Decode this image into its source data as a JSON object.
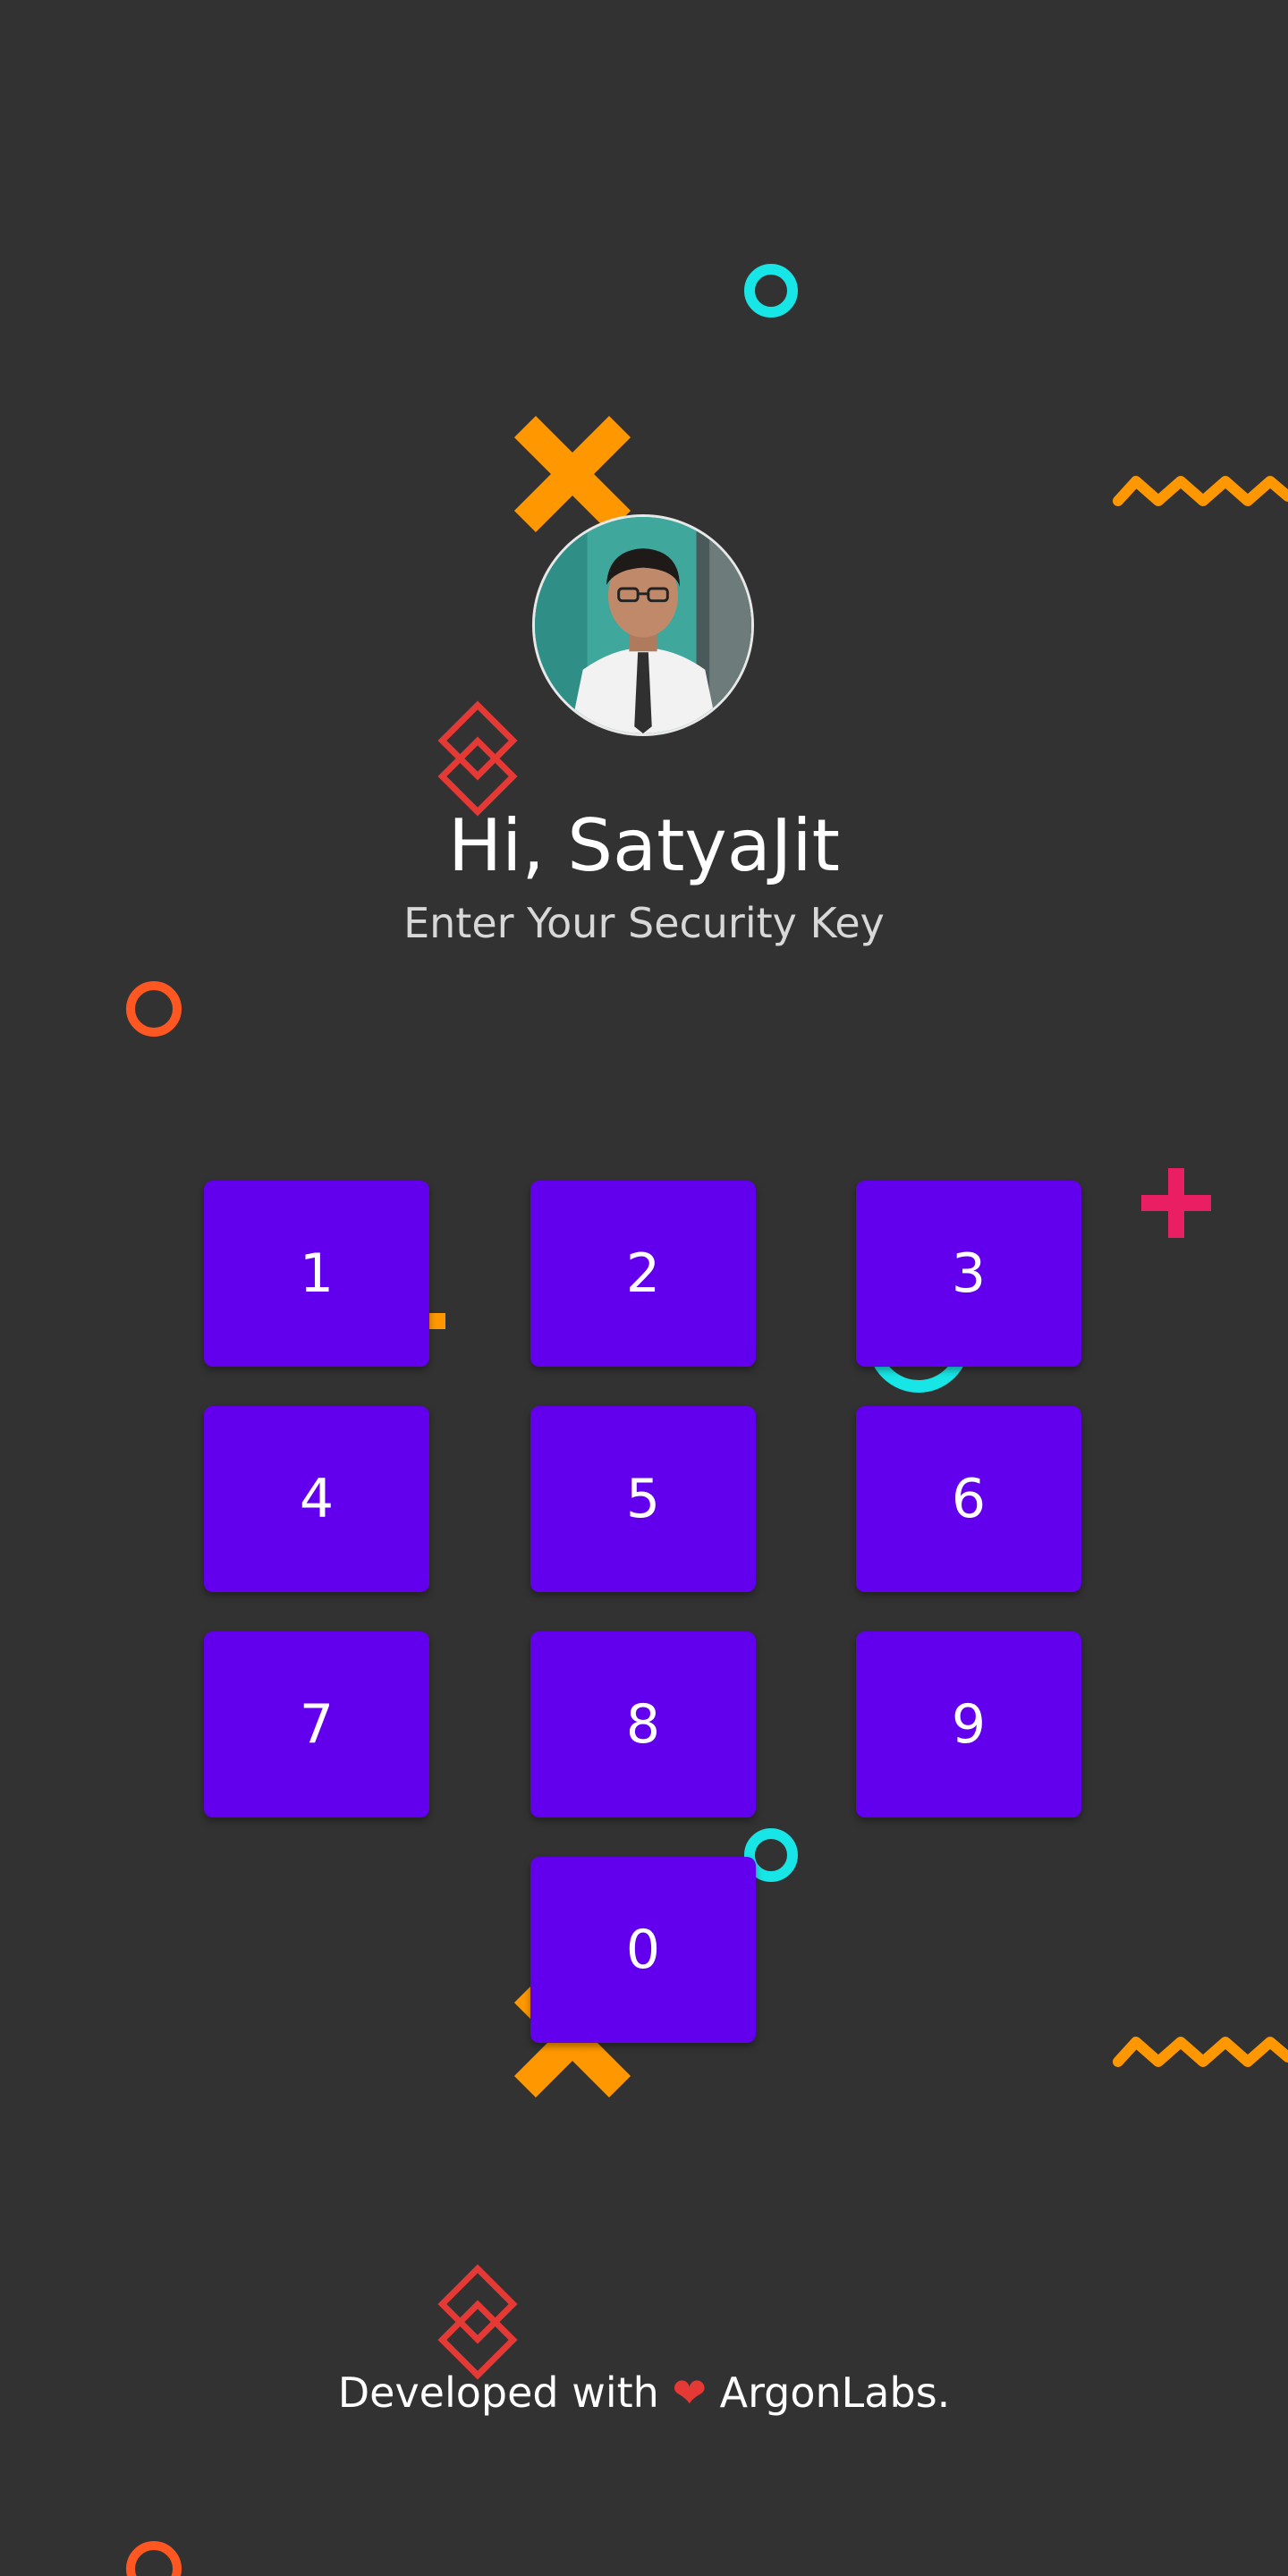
{
  "header": {
    "greeting": "Hi, SatyaJit",
    "subtitle": "Enter Your Security Key"
  },
  "avatar": {
    "name": "user-avatar"
  },
  "keypad": {
    "keys": [
      "1",
      "2",
      "3",
      "4",
      "5",
      "6",
      "7",
      "8",
      "9",
      "0"
    ]
  },
  "footer": {
    "prefix": "Developed with",
    "heart": "❤",
    "suffix": "ArgonLabs."
  },
  "colors": {
    "background": "#323232",
    "key": "#6200ee",
    "cyan": "#18e5e5",
    "orange": "#ff9800",
    "pink": "#e91e63",
    "red": "#e53935"
  }
}
